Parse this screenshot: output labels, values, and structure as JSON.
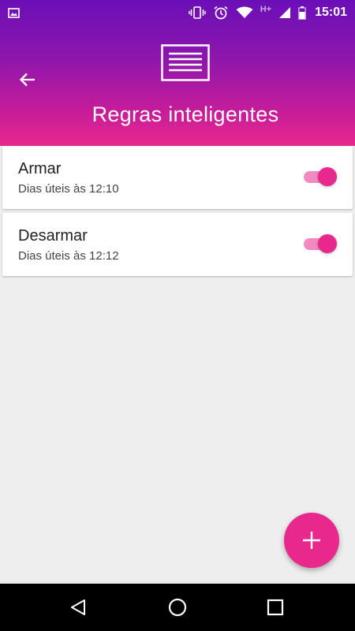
{
  "status_bar": {
    "network": "H+",
    "time": "15:01"
  },
  "header": {
    "title": "Regras inteligentes",
    "back_icon": "arrow-left-icon",
    "logo_icon": "document-lines-icon"
  },
  "rules": [
    {
      "name": "Armar",
      "schedule": "Dias úteis às 12:10",
      "enabled": true
    },
    {
      "name": "Desarmar",
      "schedule": "Dias úteis às 12:12",
      "enabled": true
    }
  ],
  "fab": {
    "icon": "plus-icon"
  },
  "nav_bar": {
    "back": "triangle-back-icon",
    "home": "circle-home-icon",
    "recents": "square-recents-icon"
  },
  "colors": {
    "accent": "#e8288d",
    "header_top": "#6a0fb7",
    "background": "#eeeeee"
  }
}
